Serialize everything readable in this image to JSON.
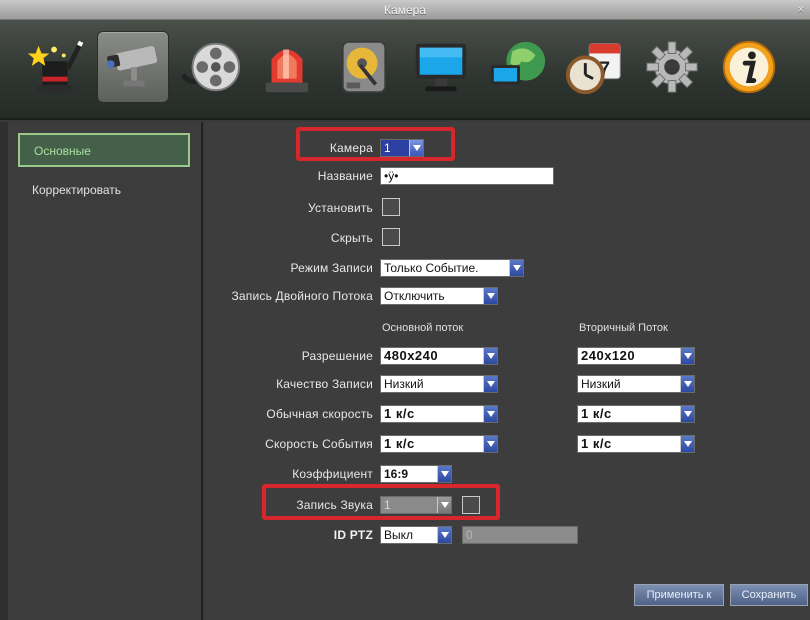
{
  "window": {
    "title": "Камера",
    "close": "×"
  },
  "toolbar": {
    "items": [
      {
        "icon": "magic-hat-icon",
        "active": false
      },
      {
        "icon": "camera-icon",
        "active": true
      },
      {
        "icon": "film-reel-icon",
        "active": false
      },
      {
        "icon": "alarm-siren-icon",
        "active": false
      },
      {
        "icon": "hard-disk-icon",
        "active": false
      },
      {
        "icon": "monitor-icon",
        "active": false
      },
      {
        "icon": "network-globe-icon",
        "active": false
      },
      {
        "icon": "clock-calendar-icon",
        "active": false
      },
      {
        "icon": "gear-icon",
        "active": false
      },
      {
        "icon": "info-icon",
        "active": false
      }
    ],
    "calendar_day": "7"
  },
  "sidebar": {
    "items": [
      {
        "label": "Основные",
        "active": true
      },
      {
        "label": "Корректировать",
        "active": false
      }
    ]
  },
  "form": {
    "camera": {
      "label": "Камера",
      "value": "1"
    },
    "name": {
      "label": "Название",
      "value": "•ÿ•"
    },
    "install": {
      "label": "Установить"
    },
    "hide": {
      "label": "Скрыть"
    },
    "record_mode": {
      "label": "Режим Записи",
      "value": "Только Событие."
    },
    "dual_stream": {
      "label": "Запись Двойного Потока",
      "value": "Отключить"
    },
    "columns": {
      "main": "Основной поток",
      "secondary": "Вторичный Поток"
    },
    "resolution": {
      "label": "Разрешение",
      "main": "480x240",
      "secondary": "240x120"
    },
    "quality": {
      "label": "Качество Записи",
      "main": "Низкий",
      "secondary": "Низкий"
    },
    "normal_rate": {
      "label": "Обычная скорость",
      "main": "1 к/с",
      "secondary": "1 к/с"
    },
    "event_rate": {
      "label": "Скорость События",
      "main": "1 к/с",
      "secondary": "1 к/с"
    },
    "aspect": {
      "label": "Коэффициент",
      "value": "16:9"
    },
    "audio": {
      "label": "Запись Звука",
      "value": "1"
    },
    "ptz": {
      "label": "ID PTZ",
      "value": "Выкл",
      "address": "0"
    }
  },
  "buttons": {
    "apply": "Применить к",
    "save": "Сохранить"
  },
  "colors": {
    "highlight": "#d8262d",
    "active_tab": "#9bc98a",
    "dropdown_arrow": "#2c49a0"
  }
}
